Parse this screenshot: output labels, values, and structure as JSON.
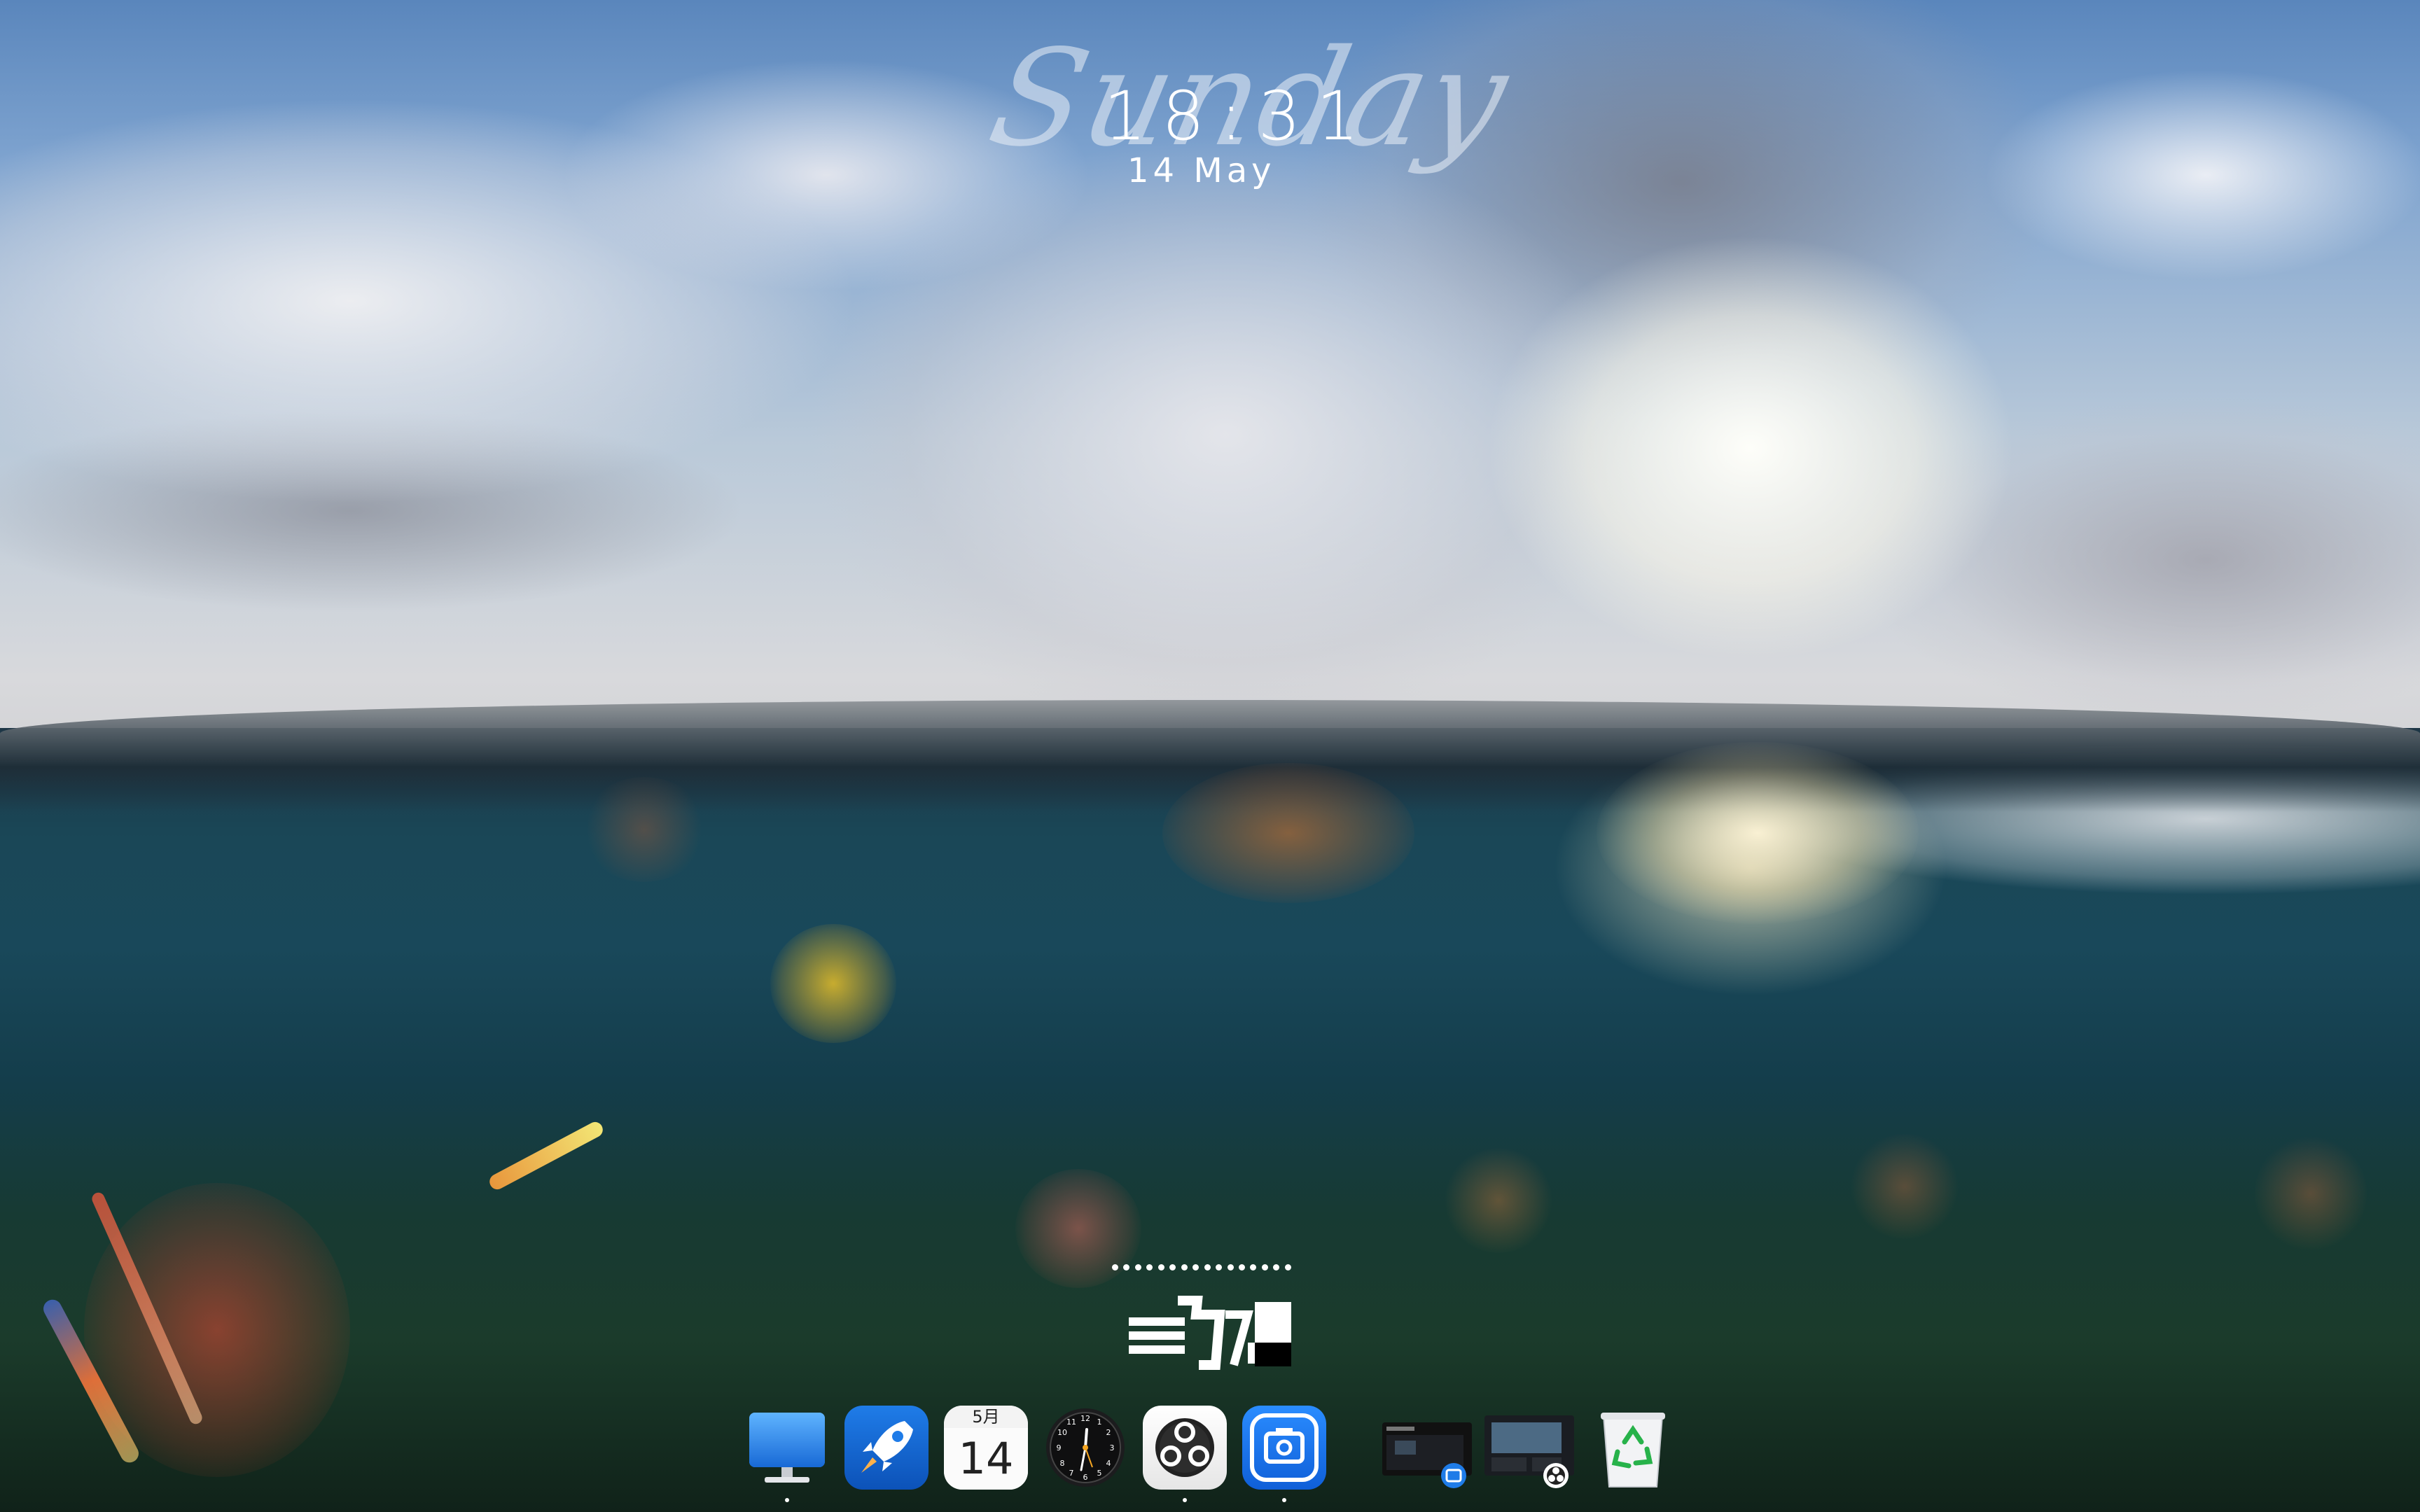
{
  "clock": {
    "day_script": "Sunday",
    "time": "18:31",
    "date": "14 May"
  },
  "dock": {
    "items": [
      {
        "name": "finder-icon",
        "running": true
      },
      {
        "name": "launchpad-icon",
        "running": false
      },
      {
        "name": "calendar-icon",
        "running": false,
        "month": "5月",
        "day": "14"
      },
      {
        "name": "clock-icon",
        "running": false
      },
      {
        "name": "obs-icon",
        "running": true
      },
      {
        "name": "screenshot-app-icon",
        "running": true
      }
    ],
    "recent_windows": [
      {
        "name": "recent-window-screenshot-app"
      },
      {
        "name": "recent-window-obs"
      }
    ],
    "trash": {
      "name": "trash-icon"
    }
  },
  "colors": {
    "accent_blue": "#1f7ce8",
    "trash_recycle": "#27b24a"
  }
}
